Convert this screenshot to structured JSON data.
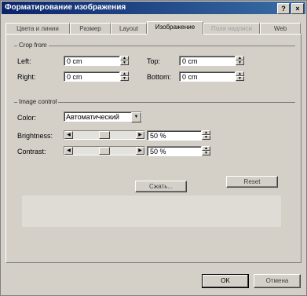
{
  "window": {
    "title": "Форматирование изображения",
    "help_label": "?",
    "close_label": "×"
  },
  "tabs": [
    {
      "label": "Цвета и линии"
    },
    {
      "label": "Размер"
    },
    {
      "label": "Layout"
    },
    {
      "label": "Изображение"
    },
    {
      "label": "Поля надписи"
    },
    {
      "label": "Web"
    }
  ],
  "crop": {
    "title": "Crop from",
    "left_label": "Left:",
    "left_value": "0 cm",
    "right_label": "Right:",
    "right_value": "0 cm",
    "top_label": "Top:",
    "top_value": "0 cm",
    "bottom_label": "Bottom:",
    "bottom_value": "0 cm"
  },
  "image_control": {
    "title": "Image control",
    "color_label": "Color:",
    "color_value": "Автоматический",
    "brightness_label": "Brightness:",
    "brightness_value": "50 %",
    "contrast_label": "Contrast:",
    "contrast_value": "50 %",
    "brightness_level": 0.5,
    "contrast_level": 0.5
  },
  "panel_buttons": {
    "compress": "Сжать...",
    "reset": "Reset"
  },
  "footer": {
    "ok": "OK",
    "cancel": "Отмена"
  }
}
